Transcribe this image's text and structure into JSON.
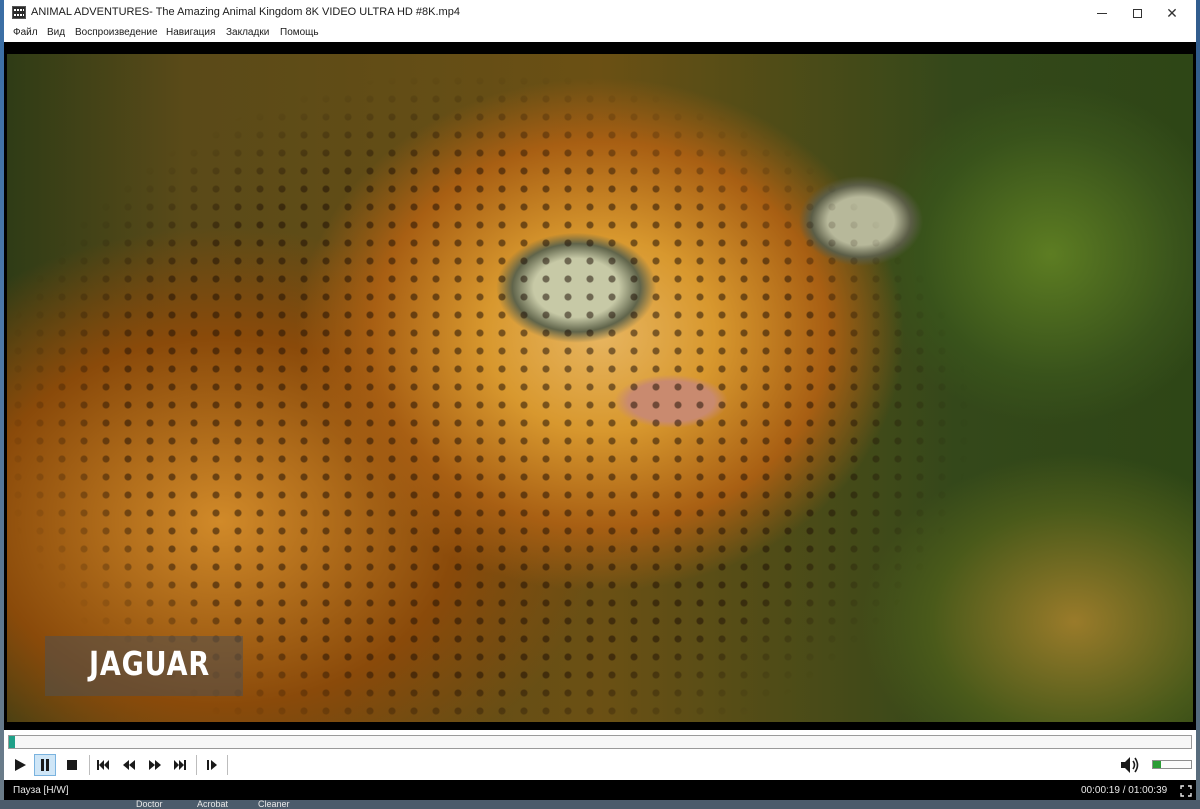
{
  "window": {
    "title": "ANIMAL ADVENTURES- The Amazing Animal Kingdom 8K VIDEO ULTRA HD #8K.mp4",
    "minimize_label": "",
    "maximize_label": "",
    "close_label": "✕"
  },
  "menu": {
    "items": [
      "Файл",
      "Вид",
      "Воспроизведение",
      "Навигация",
      "Закладки",
      "Помощь"
    ]
  },
  "video": {
    "caption": "JAGUAR"
  },
  "seek": {
    "progress": 0.005
  },
  "controls": {
    "icons": [
      "play-icon",
      "pause-icon",
      "stop-icon",
      "skip-back-icon",
      "rewind-icon",
      "fast-forward-icon",
      "skip-forward-icon",
      "frame-step-icon"
    ],
    "active": "pause-icon"
  },
  "volume": {
    "level": 0.2,
    "icon": "speaker-icon"
  },
  "status": {
    "state": "Пауза [H/W]",
    "time": "00:00:19 / 01:00:39"
  },
  "taskbar": {
    "items": [
      "Doctor",
      "Acrobat",
      "Cleaner"
    ]
  },
  "colors": {
    "seek_fill": "#1fa088",
    "volume_fill": "#2a9c34",
    "active_button": "#cfe6f7"
  }
}
